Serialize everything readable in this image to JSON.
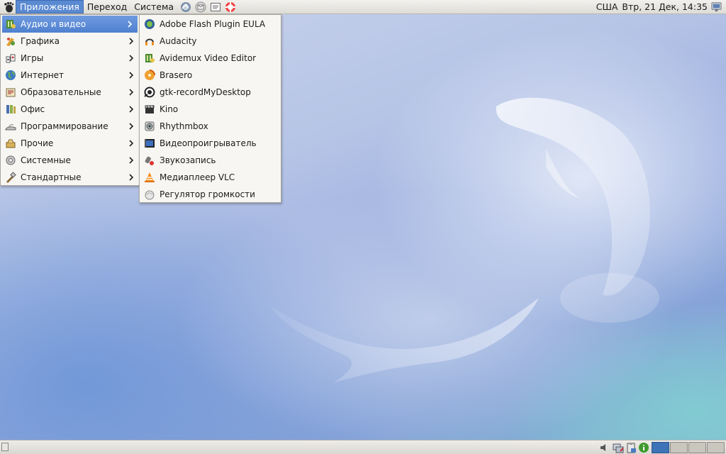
{
  "top_panel": {
    "menus": [
      "Приложения",
      "Переход",
      "Система"
    ],
    "launchers": [
      "web-browser-icon",
      "mail-icon",
      "text-editor-icon",
      "help-icon"
    ],
    "region": "США",
    "clock": "Втр, 21 Дек, 14:35",
    "tray_icon": "network-icon"
  },
  "applications_menu": {
    "items": [
      {
        "label": "Аудио и видео",
        "icon": "multimedia-icon",
        "highlighted": true
      },
      {
        "label": "Графика",
        "icon": "graphics-icon"
      },
      {
        "label": "Игры",
        "icon": "games-icon"
      },
      {
        "label": "Интернет",
        "icon": "internet-icon"
      },
      {
        "label": "Образовательные",
        "icon": "education-icon"
      },
      {
        "label": "Офис",
        "icon": "office-icon"
      },
      {
        "label": "Программирование",
        "icon": "programming-icon"
      },
      {
        "label": "Прочие",
        "icon": "other-icon"
      },
      {
        "label": "Системные",
        "icon": "system-tools-icon"
      },
      {
        "label": "Стандартные",
        "icon": "accessories-icon"
      }
    ]
  },
  "submenu": {
    "items": [
      {
        "label": "Adobe Flash Plugin EULA",
        "icon": "flash-plugin-icon"
      },
      {
        "label": "Audacity",
        "icon": "audacity-icon"
      },
      {
        "label": "Avidemux Video Editor",
        "icon": "avidemux-icon"
      },
      {
        "label": "Brasero",
        "icon": "brasero-icon"
      },
      {
        "label": "gtk-recordMyDesktop",
        "icon": "record-desktop-icon"
      },
      {
        "label": "Kino",
        "icon": "kino-icon"
      },
      {
        "label": "Rhythmbox",
        "icon": "rhythmbox-icon"
      },
      {
        "label": "Видеопроигрыватель",
        "icon": "video-player-icon"
      },
      {
        "label": "Звукозапись",
        "icon": "sound-recorder-icon"
      },
      {
        "label": "Медиаплеер VLC",
        "icon": "vlc-icon"
      },
      {
        "label": "Регулятор громкости",
        "icon": "volume-control-icon"
      }
    ]
  },
  "bottom_panel": {
    "tray_icons": [
      "volume-icon",
      "network-manager-icon",
      "clipboard-icon",
      "update-notifier-icon"
    ],
    "workspaces": 4,
    "active_workspace": 1
  },
  "colors": {
    "highlight": "#5a8ad2",
    "panel": "#e8e6e1",
    "desktop_blue": "#98acde",
    "desktop_teal": "#7fb7cf"
  }
}
